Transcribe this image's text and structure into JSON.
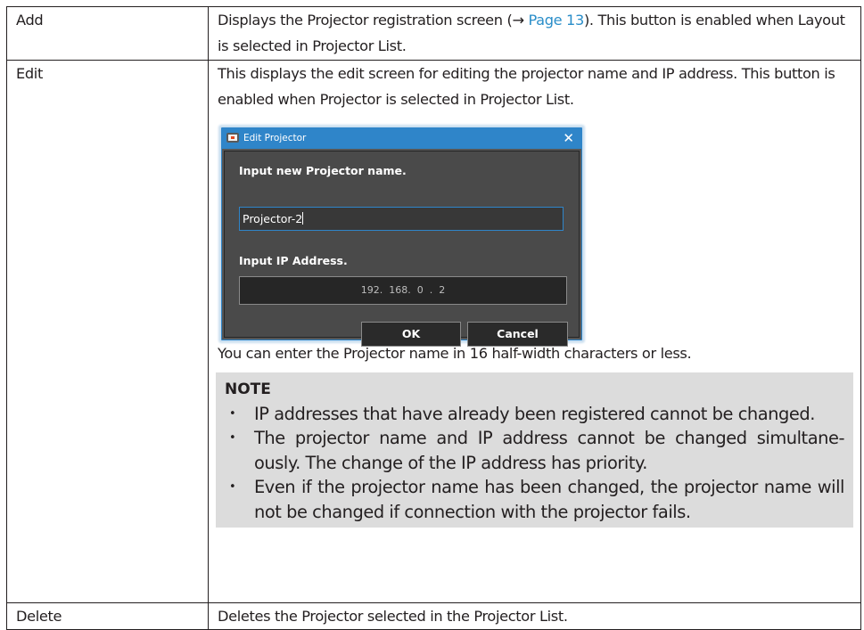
{
  "rows": [
    {
      "term": "Add",
      "desc_before": "Displays the Projector registration screen (→ ",
      "desc_link": "Page 13",
      "desc_after": "). This button is enabled when Layout is selected in Projector List."
    },
    {
      "term": "Edit",
      "desc": "This displays the edit screen for editing the projector name and IP address. This button is enabled when Projector is selected in Projector List.",
      "after_dialog": "You can enter the Projector name in 16 half-width characters or less."
    },
    {
      "term": "Delete",
      "desc": "Deletes the Projector selected in the Projector List."
    }
  ],
  "dialog": {
    "title": "Edit Projector",
    "close_glyph": "✕",
    "name_label": "Input new Projector name.",
    "name_value": "Projector-2",
    "ip_label": "Input IP Address.",
    "ip_value": "192.  168.  0  .  2",
    "ok_label": "OK",
    "cancel_label": "Cancel",
    "colors": {
      "titlebar": "#2f85c9",
      "body": "#4a4a4a",
      "field": "#262626"
    }
  },
  "note": {
    "title": "NOTE",
    "items": [
      "IP addresses that have already been registered cannot be changed.",
      "The projector name and IP address cannot be changed simultane-ously. The change of the IP address has priority.",
      "Even if the projector name has been changed, the projector name will not be changed if connection with the projector fails."
    ]
  },
  "colors": {
    "link": "#2a8ec9",
    "note_bg": "#dcdcdc",
    "border": "#231f20"
  }
}
